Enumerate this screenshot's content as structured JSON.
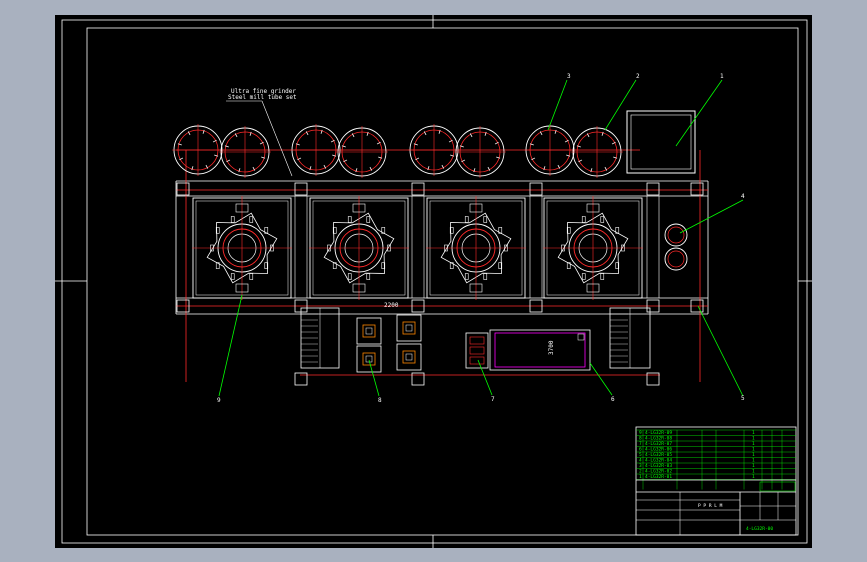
{
  "drawing": {
    "note_text": "Ultra fine grinder",
    "note_sub": "Steel mill tube set",
    "dim_top": "2200",
    "dim_mid": "3700",
    "drawing_number": "4-LG32R-00",
    "title_cells": [
      "P P R L M"
    ]
  },
  "callouts": [
    "1",
    "2",
    "3",
    "4",
    "5",
    "6",
    "7",
    "8",
    "9"
  ],
  "parts_list": {
    "rows": [
      {
        "no": "9",
        "code": "4-LG32R-09",
        "name": "",
        "qty": "1"
      },
      {
        "no": "8",
        "code": "4-LG32R-08",
        "name": "",
        "qty": "1"
      },
      {
        "no": "7",
        "code": "4-LG32R-07",
        "name": "",
        "qty": "1"
      },
      {
        "no": "6",
        "code": "4-LG32R-06",
        "name": "",
        "qty": "1"
      },
      {
        "no": "5",
        "code": "4-LG32R-05",
        "name": "",
        "qty": "1"
      },
      {
        "no": "4",
        "code": "4-LG32R-04",
        "name": "",
        "qty": "1"
      },
      {
        "no": "3",
        "code": "4-LG32R-03",
        "name": "",
        "qty": "1"
      },
      {
        "no": "2",
        "code": "4-LG32R-02",
        "name": "",
        "qty": "1"
      },
      {
        "no": "1",
        "code": "4-LG32R-01",
        "name": "",
        "qty": "1"
      }
    ]
  },
  "colors": {
    "background": "#000000",
    "line": "#ffffff",
    "center": "#ff2a2a",
    "leader": "#00ff00",
    "accent": "#ff00ff",
    "frame": "#a9b1bf"
  }
}
